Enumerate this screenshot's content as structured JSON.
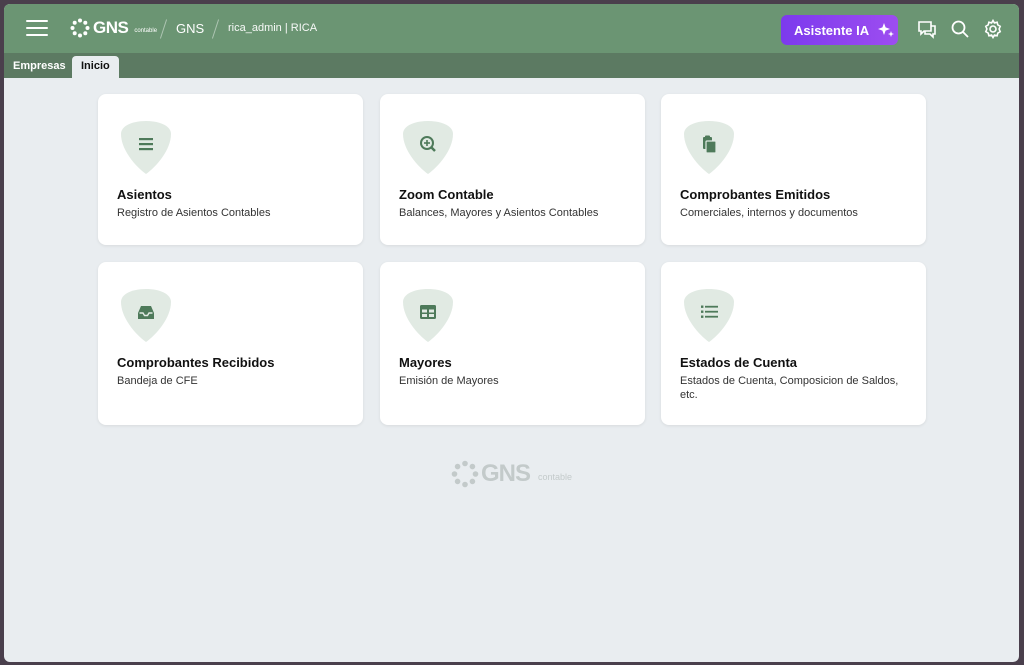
{
  "header": {
    "logo_text": "GNS",
    "logo_sub": "contable",
    "breadcrumb_company": "GNS",
    "breadcrumb_user": "rica_admin | RICA",
    "ai_button_label": "Asistente IA"
  },
  "tabs": [
    {
      "label": "Empresas"
    },
    {
      "label": "Inicio"
    }
  ],
  "cards": [
    {
      "title": "Asientos",
      "description": "Registro de Asientos Contables",
      "icon": "list-icon"
    },
    {
      "title": "Zoom Contable",
      "description": "Balances, Mayores y Asientos Contables",
      "icon": "zoom-in-icon"
    },
    {
      "title": "Comprobantes Emitidos",
      "description": "Comerciales, internos y documentos",
      "icon": "clipboard-icon"
    },
    {
      "title": "Comprobantes Recibidos",
      "description": "Bandeja de CFE",
      "icon": "inbox-icon"
    },
    {
      "title": "Mayores",
      "description": "Emisión de Mayores",
      "icon": "table-icon"
    },
    {
      "title": "Estados de Cuenta",
      "description": "Estados de Cuenta, Composicion de Saldos, etc.",
      "icon": "bullet-list-icon"
    }
  ],
  "footer": {
    "logo_text": "GNS",
    "logo_sub": "contable"
  },
  "colors": {
    "header": "#6b9573",
    "tabstrip": "#5c7a62",
    "accent": "#7c3aed",
    "icon": "#4e7a5a",
    "badge": "#e1eae3"
  }
}
